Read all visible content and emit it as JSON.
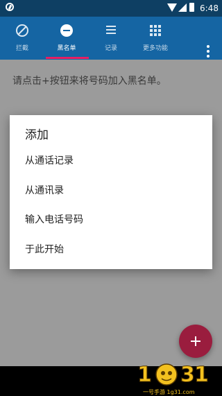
{
  "status_bar": {
    "time": "6:48",
    "icons": [
      "app-icon",
      "wifi-icon",
      "signal-icon",
      "battery-icon"
    ]
  },
  "tabs": [
    {
      "label": "拦截",
      "icon": "block-icon",
      "active": false
    },
    {
      "label": "黑名单",
      "icon": "minus-circle-icon",
      "active": true
    },
    {
      "label": "记录",
      "icon": "list-icon",
      "active": false
    },
    {
      "label": "更多功能",
      "icon": "grid-icon",
      "active": false
    }
  ],
  "main": {
    "hint": "请点击+按钮来将号码加入黑名单。"
  },
  "dialog": {
    "title": "添加",
    "items": [
      {
        "label": "从通话记录"
      },
      {
        "label": "从通讯录"
      },
      {
        "label": "输入电话号码"
      },
      {
        "label": "于此开始"
      }
    ]
  },
  "fab": {
    "icon": "plus-icon"
  },
  "watermark": {
    "text": "一号手游 1g31.com"
  },
  "colors": {
    "status_bar": "#0e3f63",
    "tab_bar": "#1565a3",
    "indicator": "#e91e63",
    "fab": "#9a1d3e",
    "scrim": "#9b9b9b"
  }
}
